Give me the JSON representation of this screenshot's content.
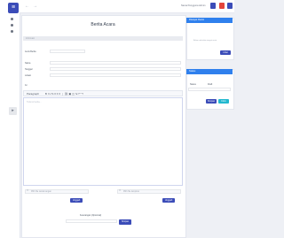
{
  "app": {
    "logo": "≡"
  },
  "topbar": {
    "user_name": "Nama Pengguna Admin",
    "icons": [
      "back-arrow-icon",
      "forward-icon"
    ]
  },
  "colors": {
    "primary": "#3b4cb8",
    "accent": "#2f80ed",
    "secondary": "#22b8cf",
    "avatar1": "#e3443b",
    "avatar2": "#3b4cb8"
  },
  "document": {
    "title": "Berita Acara",
    "section_bar": "Informasi",
    "meta": {
      "label_type": "Jenis Berita",
      "value_type": "—"
    },
    "fields": [
      {
        "label": "Nama"
      },
      {
        "label": "Tanggal"
      },
      {
        "label": "Lokasi"
      },
      {
        "label": "Isi"
      }
    ],
    "toolbar": {
      "paragraph": "Paragraph",
      "items": "B  I  U  S  ≡  ≡  ≡  ⋮  ⛓  ▣  ◫  ⇲  ↶  ↷"
    },
    "editor_placeholder": "Tulis isi berita...",
    "uploads": [
      {
        "placeholder": "Pilih file tanda tangan",
        "button": "Unggah"
      },
      {
        "placeholder": "Pilih file lampiran",
        "button": "Unggah"
      }
    ],
    "footer": {
      "label": "Keterangan (Opsional)",
      "button": "Simpan"
    }
  },
  "panel_top": {
    "title": "Riwayat Revisi",
    "empty_text": "Belum ada data riwayat revisi.",
    "button": "Lihat"
  },
  "panel_bottom": {
    "title": "Status",
    "label": "Status",
    "value": "Draft",
    "btn_primary": "Simpan",
    "btn_secondary": "Kirim"
  }
}
